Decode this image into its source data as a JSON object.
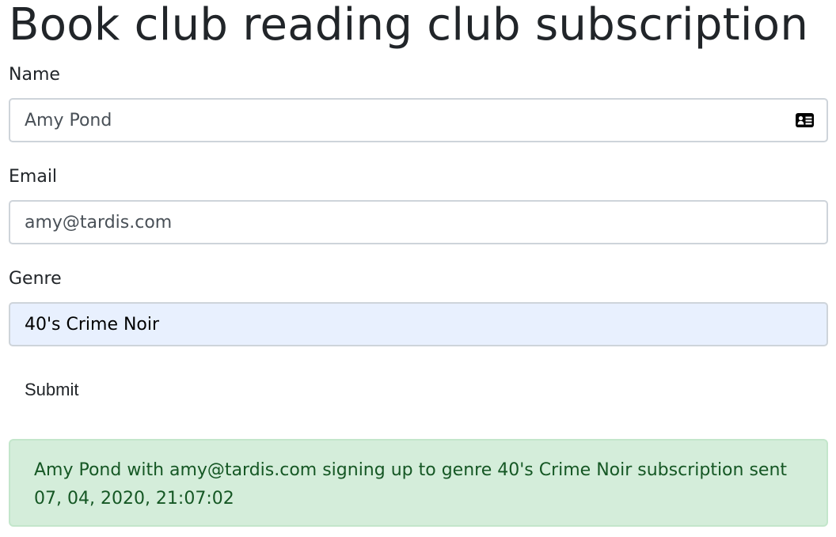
{
  "page": {
    "title": "Book club reading club subscription"
  },
  "form": {
    "name": {
      "label": "Name",
      "value": "Amy Pond",
      "icon": "contact-card-icon"
    },
    "email": {
      "label": "Email",
      "value": "amy@tardis.com"
    },
    "genre": {
      "label": "Genre",
      "value": "40's Crime Noir"
    },
    "submit_label": "Submit"
  },
  "alert": {
    "message": "Amy Pond with amy@tardis.com signing up to genre 40's Crime Noir subscription sent 07, 04, 2020, 21:07:02"
  },
  "colors": {
    "alert_background": "#d4edda",
    "alert_text": "#155724",
    "autofill_background": "#e8f0fe",
    "input_border": "#ced4da"
  }
}
